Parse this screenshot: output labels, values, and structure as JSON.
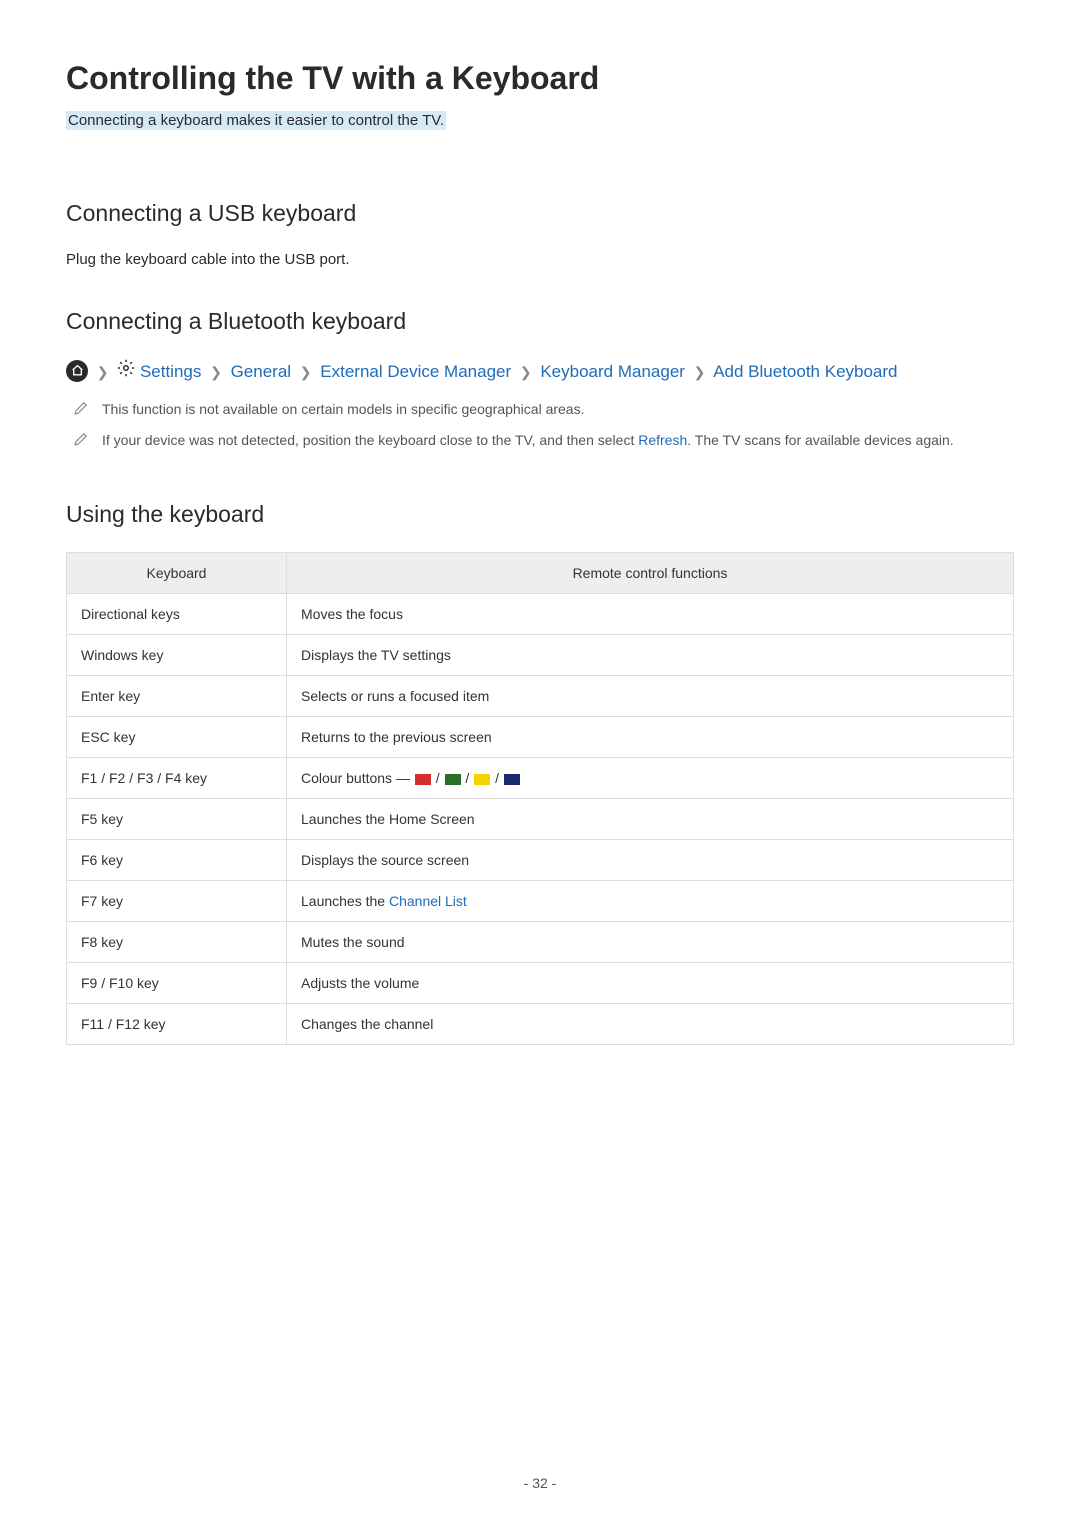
{
  "title": "Controlling the TV with a Keyboard",
  "subtitle": "Connecting a keyboard makes it easier to control the TV.",
  "section_usb": {
    "heading": "Connecting a USB keyboard",
    "body": "Plug the keyboard cable into the USB port."
  },
  "section_bluetooth": {
    "heading": "Connecting a Bluetooth keyboard",
    "nav": {
      "settings": "Settings",
      "general": "General",
      "external": "External Device Manager",
      "keyboard_mgr": "Keyboard Manager",
      "add_bt": "Add Bluetooth Keyboard"
    },
    "note1": "This function is not available on certain models in specific geographical areas.",
    "note2_pre": "If your device was not detected, position the keyboard close to the TV, and then select ",
    "note2_link": "Refresh",
    "note2_post": ". The TV scans for available devices again."
  },
  "section_using": {
    "heading": "Using the keyboard",
    "th1": "Keyboard",
    "th2": "Remote control functions",
    "rows": [
      {
        "k": "Directional keys",
        "v": "Moves the focus"
      },
      {
        "k": "Windows key",
        "v": "Displays the TV settings"
      },
      {
        "k": "Enter key",
        "v": "Selects or runs a focused item"
      },
      {
        "k": "ESC key",
        "v": "Returns to the previous screen"
      },
      {
        "k": "F1 / F2 / F3 / F4 key",
        "v": "Colour buttons ―"
      },
      {
        "k": "F5 key",
        "v": "Launches the Home Screen"
      },
      {
        "k": "F6 key",
        "v": "Displays the source screen"
      },
      {
        "k": "F7 key",
        "v_pre": "Launches the ",
        "v_link": "Channel List"
      },
      {
        "k": "F8 key",
        "v": "Mutes the sound"
      },
      {
        "k": "F9 / F10 key",
        "v": "Adjusts the volume"
      },
      {
        "k": "F11 / F12 key",
        "v": "Changes the channel"
      }
    ]
  },
  "page_number": "- 32 -"
}
